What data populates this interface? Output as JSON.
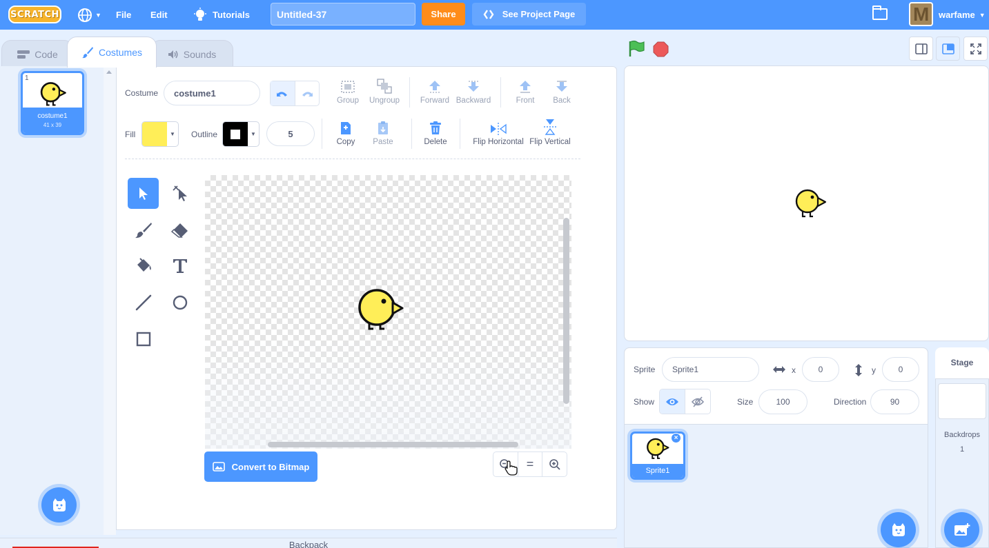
{
  "menubar": {
    "logo": "SCRATCH",
    "file": "File",
    "edit": "Edit",
    "tutorials": "Tutorials",
    "project_title": "Untitled-37",
    "share": "Share",
    "see_project": "See Project Page",
    "username": "warfame"
  },
  "tabs": {
    "code": "Code",
    "costumes": "Costumes",
    "sounds": "Sounds"
  },
  "costumes": [
    {
      "number": "1",
      "name": "costume1",
      "size": "41 x 39"
    }
  ],
  "editor": {
    "costume_label": "Costume",
    "costume_name": "costume1",
    "fill_label": "Fill",
    "fill_color": "#ffee58",
    "outline_label": "Outline",
    "outline_color": "#000000",
    "outline_width": "5",
    "group": "Group",
    "ungroup": "Ungroup",
    "forward": "Forward",
    "backward": "Backward",
    "front": "Front",
    "back": "Back",
    "copy": "Copy",
    "paste": "Paste",
    "delete": "Delete",
    "flip_h": "Flip Horizontal",
    "flip_v": "Flip Vertical",
    "convert": "Convert to Bitmap",
    "zoom_reset": "="
  },
  "backpack": "Backpack",
  "sprite": {
    "sprite_label": "Sprite",
    "name": "Sprite1",
    "x_label": "x",
    "x": "0",
    "y_label": "y",
    "y": "0",
    "show_label": "Show",
    "size_label": "Size",
    "size": "100",
    "direction_label": "Direction",
    "direction": "90"
  },
  "sprites": [
    {
      "name": "Sprite1"
    }
  ],
  "stage_panel": {
    "title": "Stage",
    "backdrops_label": "Backdrops",
    "backdrops_count": "1"
  },
  "colors": {
    "accent": "#4c97ff",
    "share": "#ff8c1a",
    "chick": "#ffee58"
  }
}
